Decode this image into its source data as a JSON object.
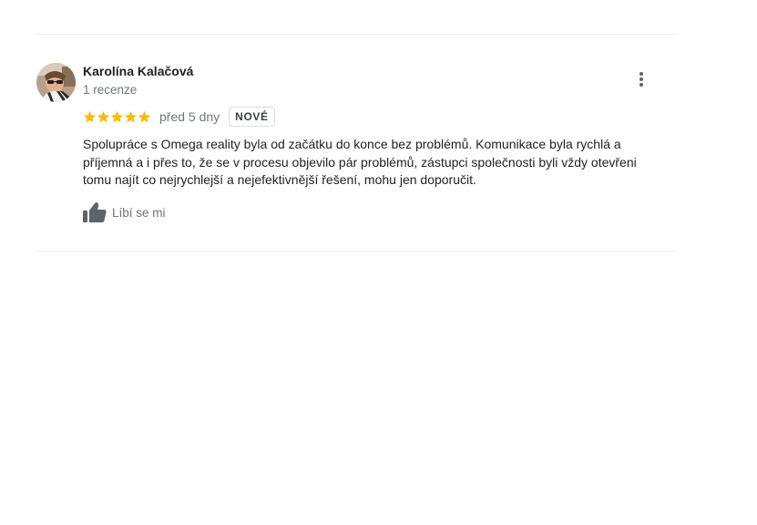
{
  "review": {
    "author": "Karolína Kalačová",
    "review_count": "1 recenze",
    "rating": 5,
    "max_rating": 5,
    "date": "před 5 dny",
    "badge": "NOVÉ",
    "text": "Spolupráce s Omega reality byla od začátku do konce bez problémů. Komunikace byla rychlá a příjemná a i přes to, že se v procesu objevilo pár problémů, zástupci společnosti byli vždy otevřeni tomu najít co nejrychlejší a nejefektivnější řešení, mohu jen doporučit.",
    "like_label": "Líbí se mi"
  },
  "icons": {
    "avatar": "avatar-photo",
    "star": "star-icon",
    "more": "more-vert-icon",
    "like": "thumb-up-icon"
  },
  "colors": {
    "star": "#fbbc04",
    "secondary_text": "#70757a",
    "primary_text": "#202124",
    "divider": "#ececec",
    "like_icon": "#5f6368"
  }
}
